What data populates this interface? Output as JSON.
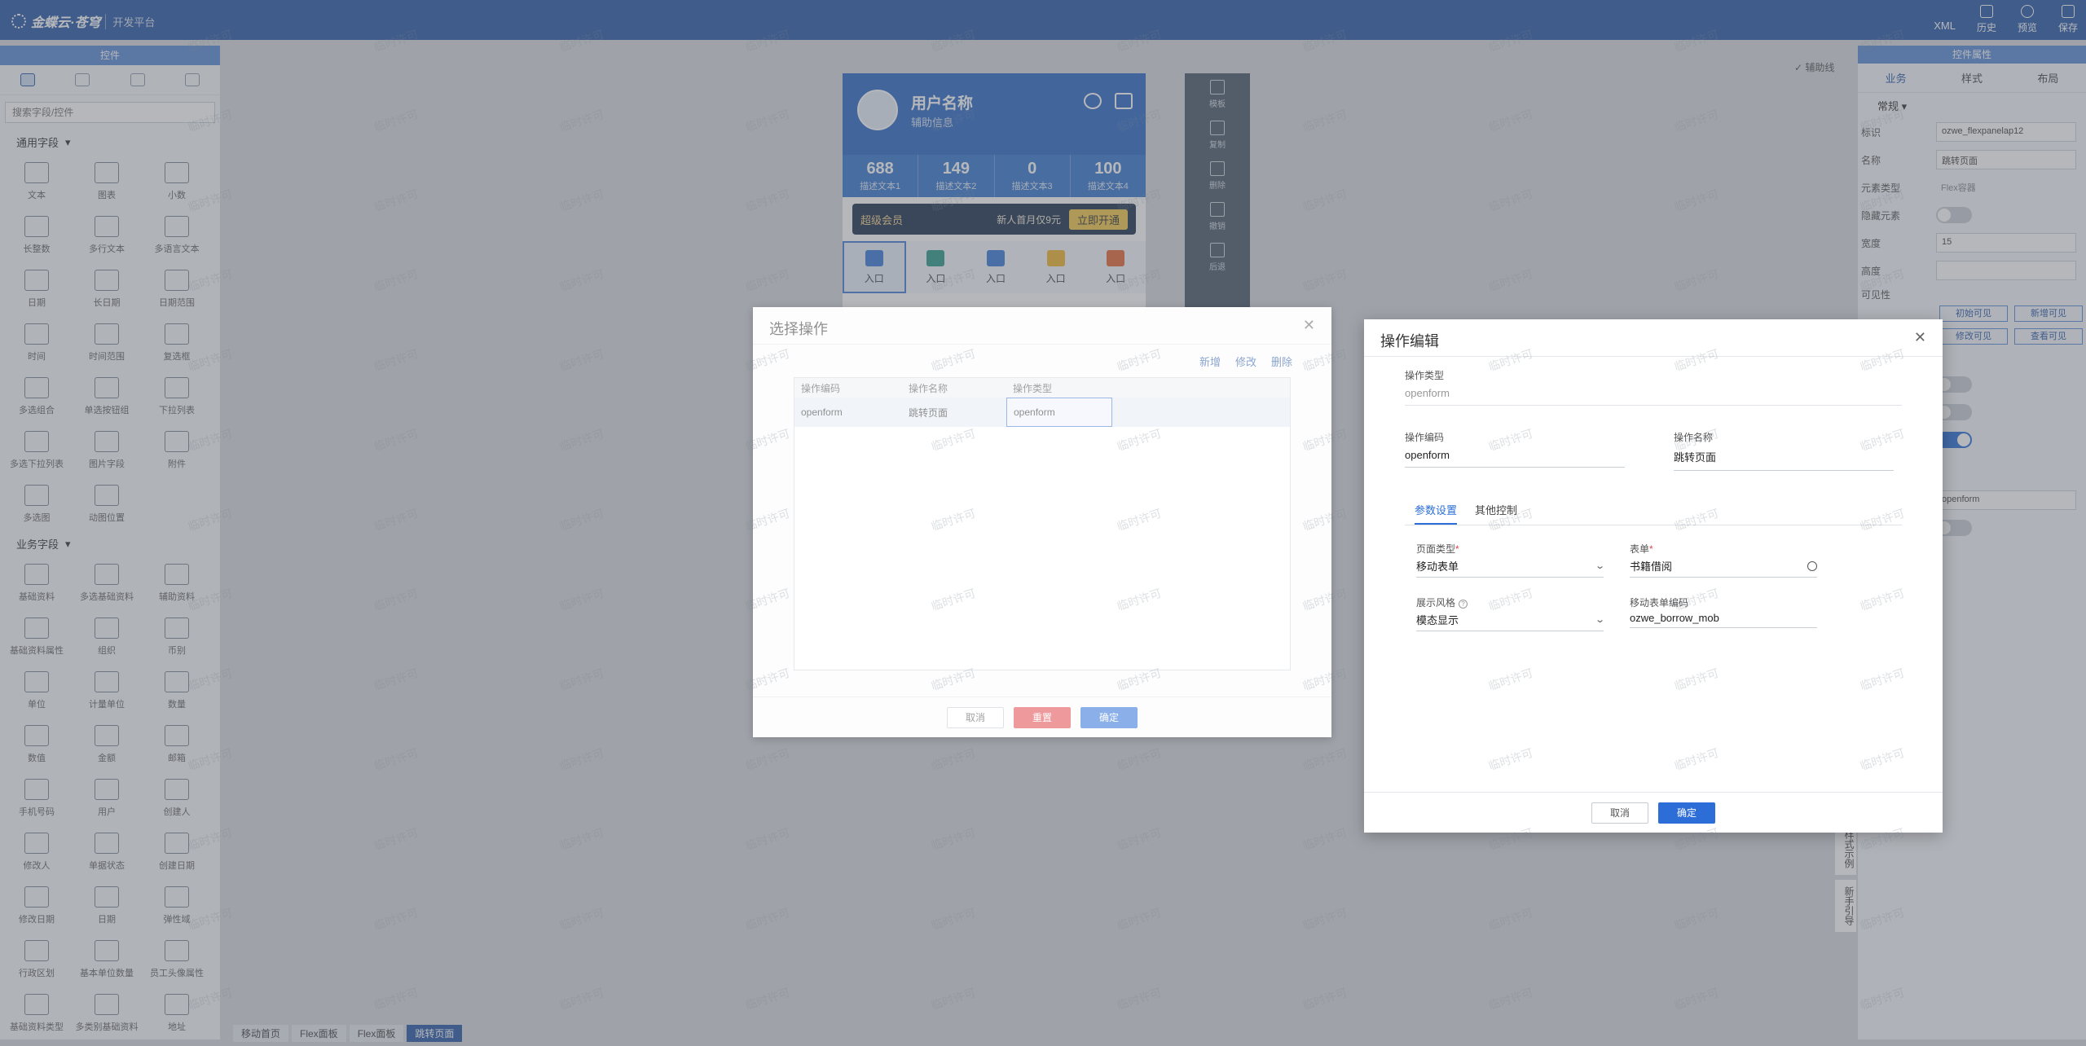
{
  "topbar": {
    "brand": "金蝶云·苍穹",
    "sub": "开发平台",
    "actions": [
      {
        "label": "XML",
        "icon": "xml-icon"
      },
      {
        "label": "历史",
        "icon": "history-icon"
      },
      {
        "label": "预览",
        "icon": "preview-eye-icon"
      },
      {
        "label": "保存",
        "icon": "save-icon"
      }
    ]
  },
  "left": {
    "header": "控件",
    "search_placeholder": "搜索字段/控件",
    "group1_title": "通用字段",
    "group1": [
      "文本",
      "图表",
      "小数",
      "长整数",
      "多行文本",
      "多语言文本",
      "日期",
      "长日期",
      "日期范围",
      "时间",
      "时间范围",
      "复选框",
      "多选组合",
      "单选按钮组",
      "下拉列表",
      "多选下拉列表",
      "图片字段",
      "附件",
      "多选图",
      "动图位置"
    ],
    "group2_title": "业务字段",
    "group2": [
      "基础资料",
      "多选基础资料",
      "辅助资料",
      "基础资料属性",
      "组织",
      "币别",
      "单位",
      "计量单位",
      "数量",
      "数值",
      "金额",
      "邮箱",
      "手机号码",
      "用户",
      "创建人",
      "修改人",
      "单据状态",
      "创建日期",
      "修改日期",
      "日期",
      "弹性域",
      "行政区划",
      "基本单位数量",
      "员工头像属性",
      "基础资料类型",
      "多类别基础资料",
      "地址"
    ]
  },
  "phone": {
    "name": "用户名称",
    "sub": "辅助信息",
    "stats": [
      {
        "value": "688",
        "label": "描述文本1"
      },
      {
        "value": "149",
        "label": "描述文本2"
      },
      {
        "value": "0",
        "label": "描述文本3"
      },
      {
        "value": "100",
        "label": "描述文本4"
      }
    ],
    "vip_title": "超级会员",
    "vip_text": "新人首月仅9元",
    "vip_btn": "立即开通",
    "entries": [
      "入口",
      "入口",
      "入口",
      "入口",
      "入口"
    ],
    "entry_colors": [
      "#3d7bd9",
      "#2f9b8a",
      "#3d7bd9",
      "#f2b632",
      "#e86b3a"
    ]
  },
  "side_tools": [
    "模板",
    "复制",
    "删除",
    "撤销",
    "后退"
  ],
  "ruler_label": "辅助线",
  "right": {
    "header": "控件属性",
    "tabs": [
      "业务",
      "样式",
      "布局"
    ],
    "section": "常规",
    "props": [
      {
        "label": "标识",
        "value": "ozwe_flexpanelap12"
      },
      {
        "label": "名称",
        "value": "跳转页面"
      },
      {
        "label": "元素类型",
        "value": "Flex容器"
      },
      {
        "label": "隐藏元素",
        "value": ""
      },
      {
        "label": "宽度",
        "value": "15"
      },
      {
        "label": "高度",
        "value": ""
      }
    ],
    "visibility_label": "可见性",
    "vis_btns": [
      "初始可见",
      "新增可见",
      "修改可见",
      "查看可见"
    ],
    "op_value": "openform",
    "vtab1": "样式示例",
    "vtab2": "新手引导"
  },
  "breadcrumbs": [
    "移动首页",
    "Flex面板",
    "Flex面板",
    "跳转页面"
  ],
  "dialog1": {
    "title": "选择操作",
    "actions": [
      "新增",
      "修改",
      "删除"
    ],
    "columns": [
      "操作编码",
      "操作名称",
      "操作类型"
    ],
    "rows": [
      {
        "code": "openform",
        "name": "跳转页面",
        "type": "openform"
      }
    ],
    "cancel": "取消",
    "reset": "重置",
    "ok": "确定"
  },
  "dialog2": {
    "title": "操作编辑",
    "op_type_label": "操作类型",
    "op_type_value": "openform",
    "op_code_label": "操作编码",
    "op_code_value": "openform",
    "op_name_label": "操作名称",
    "op_name_value": "跳转页面",
    "tabs": [
      "参数设置",
      "其他控制"
    ],
    "page_type_label": "页面类型",
    "page_type_value": "移动表单",
    "form_label": "表单",
    "form_value": "书籍借阅",
    "style_label": "展示风格",
    "style_value": "模态显示",
    "mob_form_label": "移动表单编码",
    "mob_form_value": "ozwe_borrow_mob",
    "cancel": "取消",
    "ok": "确定"
  },
  "watermark": "临时许可"
}
